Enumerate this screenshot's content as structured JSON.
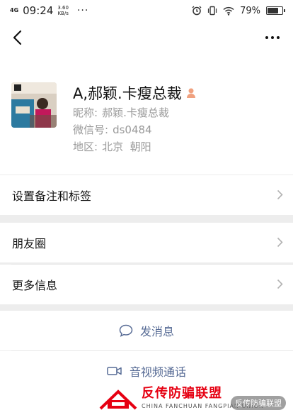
{
  "status_bar": {
    "network": "4G",
    "time": "09:24",
    "speed_value": "3.60",
    "speed_unit": "KB/s",
    "more_dots": "···",
    "battery_percent": "79%",
    "battery_level": 0.79
  },
  "nav": {
    "back_icon": "chevron-left-icon",
    "more_icon": "more-horizontal-icon"
  },
  "profile": {
    "name": "A,郝颖.卡瘦总裁",
    "gender_icon": "person-icon",
    "nickname_label": "昵称:",
    "nickname": "郝颖.卡瘦总裁",
    "wechat_id_label": "微信号:",
    "wechat_id": "ds0484",
    "region_label": "地区:",
    "region": "北京  朝阳"
  },
  "menu": {
    "remark_tags": "设置备注和标签",
    "moments": "朋友圈",
    "more_info": "更多信息"
  },
  "actions": {
    "send_message": "发消息",
    "av_call": "音视频通话"
  },
  "watermark": {
    "cn_title": "反传防骗联盟",
    "en_title": "CHINA FANCHUAN FANGPIAN UNION",
    "right_tag": "反传防骗联盟"
  },
  "colors": {
    "link": "#576b95",
    "brand_red": "#e60012",
    "background": "#ededed"
  }
}
